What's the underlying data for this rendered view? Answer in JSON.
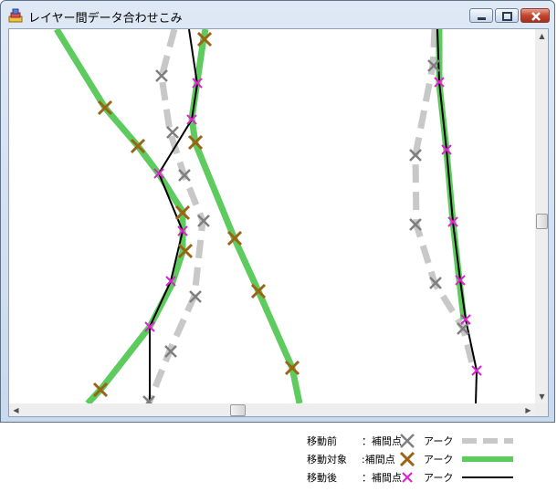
{
  "window": {
    "title": "レイヤー間データ合わせこみ",
    "icon": "app-layers-icon"
  },
  "legend": [
    {
      "name": "移動前",
      "point_label": "：補間点",
      "arc_label": "アーク",
      "point_color": "#808080",
      "line_color": "#c8c8c8",
      "line_style": "dashed"
    },
    {
      "name": "移動対象",
      "point_label": ":補間点",
      "arc_label": "アーク",
      "point_color": "#9a6414",
      "line_color": "#5bc85b",
      "line_style": "solid"
    },
    {
      "name": "移動後",
      "point_label": "：補間点",
      "arc_label": "アーク",
      "point_color": "#e61ed2",
      "line_color": "#000000",
      "line_style": "solid"
    }
  ],
  "colors": {
    "before_points": "#7f7f7f",
    "before_arc": "#c8c8c8",
    "target_points": "#9a6414",
    "target_arc": "#5ecb5e",
    "after_points": "#e020d0",
    "after_arc": "#000000"
  }
}
